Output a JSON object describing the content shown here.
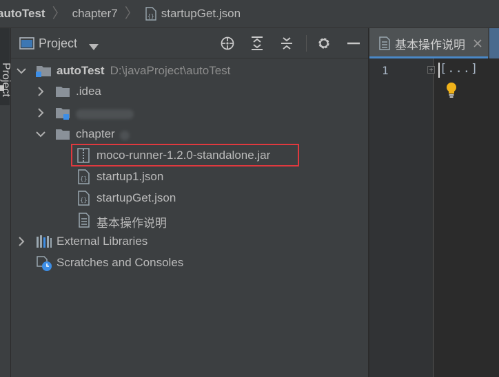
{
  "breadcrumb": {
    "items": [
      {
        "label": "autoTest",
        "icon": "none"
      },
      {
        "label": "chapter7",
        "icon": "none"
      },
      {
        "label": "startupGet.json",
        "icon": "json-file-icon"
      }
    ]
  },
  "tool_window_tab": {
    "label": "Project"
  },
  "project_panel": {
    "title": "Project",
    "toolbar": [
      "locate-icon",
      "expand-all-icon",
      "collapse-all-icon",
      "gear-icon",
      "minimize-icon"
    ]
  },
  "tree": {
    "root": {
      "label": "autoTest",
      "path": "D:\\javaProject\\autoTest"
    },
    "idea": {
      "label": ".idea"
    },
    "module": {
      "label": ""
    },
    "chapter": {
      "label": "chapter"
    },
    "jar": {
      "label": "moco-runner-1.2.0-standalone.jar"
    },
    "startup1": {
      "label": "startup1.json"
    },
    "startupGet": {
      "label": "startupGet.json"
    },
    "readme": {
      "label": "基本操作说明"
    },
    "external": {
      "label": "External Libraries"
    },
    "scratches": {
      "label": "Scratches and Consoles"
    }
  },
  "editor": {
    "tab_label": "基本操作说明",
    "line_number": "1",
    "code_text": "[...]"
  },
  "colors": {
    "panel_bg": "#3c3f41",
    "editor_bg": "#2b2b2b",
    "highlight_border": "#e0393e",
    "accent": "#4a88c7"
  }
}
